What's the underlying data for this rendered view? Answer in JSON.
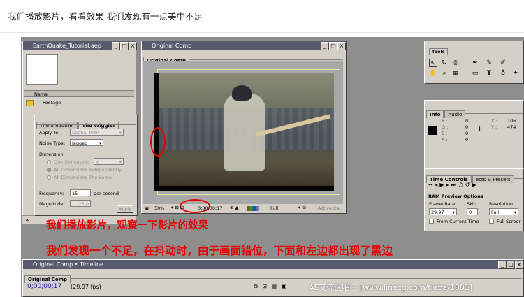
{
  "post": {
    "caption": "我们播放影片，看看效果 我们发现有一点美中不足"
  },
  "project_window": {
    "title": "EarthQuake_Tutorial.aep",
    "column_name": "Name",
    "folder_label": "Footage"
  },
  "wiggler": {
    "tab_smoother": "The Smoother",
    "tab_wiggler": "The Wiggler",
    "apply_to_label": "Apply To:",
    "apply_to_value": "Spatial Path",
    "noise_type_label": "Noise Type:",
    "noise_type_value": "Jagged",
    "dimension_label": "Dimension:",
    "one_dimension": "One Dimension",
    "one_dimension_value": "X",
    "all_independently": "All Dimensions Independently",
    "all_same": "All Dimensions The Same",
    "frequency_label": "Frequency:",
    "frequency_value": "15",
    "frequency_unit": "per second",
    "magnitude_label": "Magnitude:",
    "magnitude_value": "25.0",
    "apply_button": "Apply"
  },
  "comp_window": {
    "title": "Original Comp",
    "tab": "Original Comp",
    "zoom": "50%",
    "timecode": "0;00;00;17",
    "resolution": "Full",
    "camera": "Active Ca"
  },
  "tools": {
    "title": "Tools"
  },
  "info": {
    "tab_info": "Info",
    "tab_audio": "Audio",
    "r_label": "R :",
    "r_value": "0",
    "g_label": "G :",
    "g_value": "0",
    "b_label": "B :",
    "b_value": "0",
    "a_label": "A :",
    "a_value": "0",
    "x_label": "X :",
    "x_value": "106",
    "y_label": "Y :",
    "y_value": "474"
  },
  "time_controls": {
    "tab_time": "Time Controls",
    "tab_effects": "ects & Presets",
    "ram_title": "RAM Preview Options",
    "frame_rate_label": "Frame Rate",
    "frame_rate_value": "29.97",
    "skip_label": "Skip",
    "skip_value": "0",
    "resolution_label": "Resolution",
    "resolution_value": "Full",
    "from_current": "From Current Time",
    "full_screen": "Full Screen"
  },
  "annotations": {
    "line1": "我们播放影片，观察一下影片的效果",
    "line2": "我们发现一个不足，在抖动时，由于画面错位，下面和左边都出现了黑边"
  },
  "timeline": {
    "title": "Original Comp • Timeline",
    "tab": "Original Comp",
    "timecode": "0;00;00;17",
    "fps": "(29.97 fps)"
  },
  "watermark": "AE交流区吧一 [www.linecg.com/tieba/1801]",
  "colors": {
    "annotation_red": "#e60000",
    "workspace_gray": "#8e8e8e",
    "timecode_blue": "#1a1aa8"
  }
}
